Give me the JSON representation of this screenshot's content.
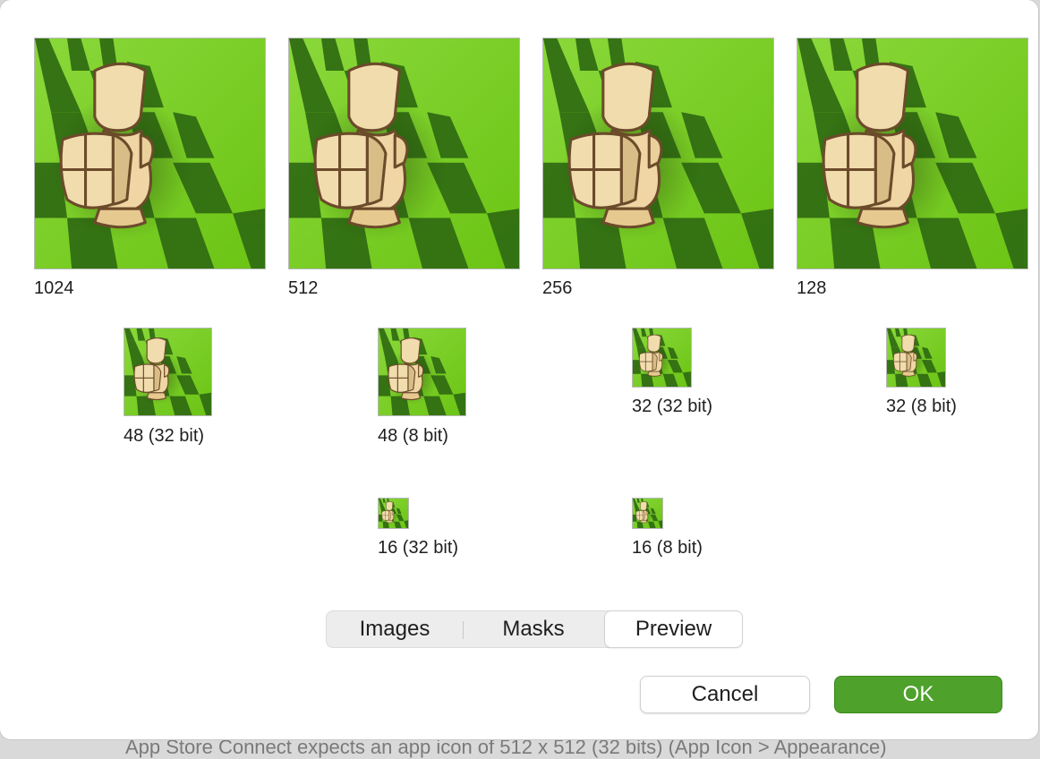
{
  "background_hint": "App Store Connect expects an app icon of 512 x 512 (32 bits) (App Icon > Appearance)",
  "icons": [
    {
      "label": "1024",
      "icon": "chess-knight-board-icon"
    },
    {
      "label": "512",
      "icon": "chess-knight-board-icon"
    },
    {
      "label": "256",
      "icon": "chess-knight-board-icon"
    },
    {
      "label": "128",
      "icon": "chess-knight-board-icon"
    },
    {
      "label": "48 (32 bit)",
      "icon": "chess-knight-board-icon"
    },
    {
      "label": "48 (8 bit)",
      "icon": "chess-knight-board-icon"
    },
    {
      "label": "32 (32 bit)",
      "icon": "chess-knight-board-icon"
    },
    {
      "label": "32 (8 bit)",
      "icon": "chess-knight-board-icon"
    },
    {
      "label": "16 (32 bit)",
      "icon": "chess-knight-board-icon"
    },
    {
      "label": "16 (8 bit)",
      "icon": "chess-knight-board-icon"
    }
  ],
  "tabs": {
    "images": "Images",
    "masks": "Masks",
    "preview": "Preview",
    "selected": "Preview"
  },
  "buttons": {
    "cancel": "Cancel",
    "ok": "OK"
  },
  "colors": {
    "board_light": "#7ed321",
    "board_dark": "#2f6b12",
    "piece": "#f1dcae",
    "ok_button": "#4ea12b"
  }
}
